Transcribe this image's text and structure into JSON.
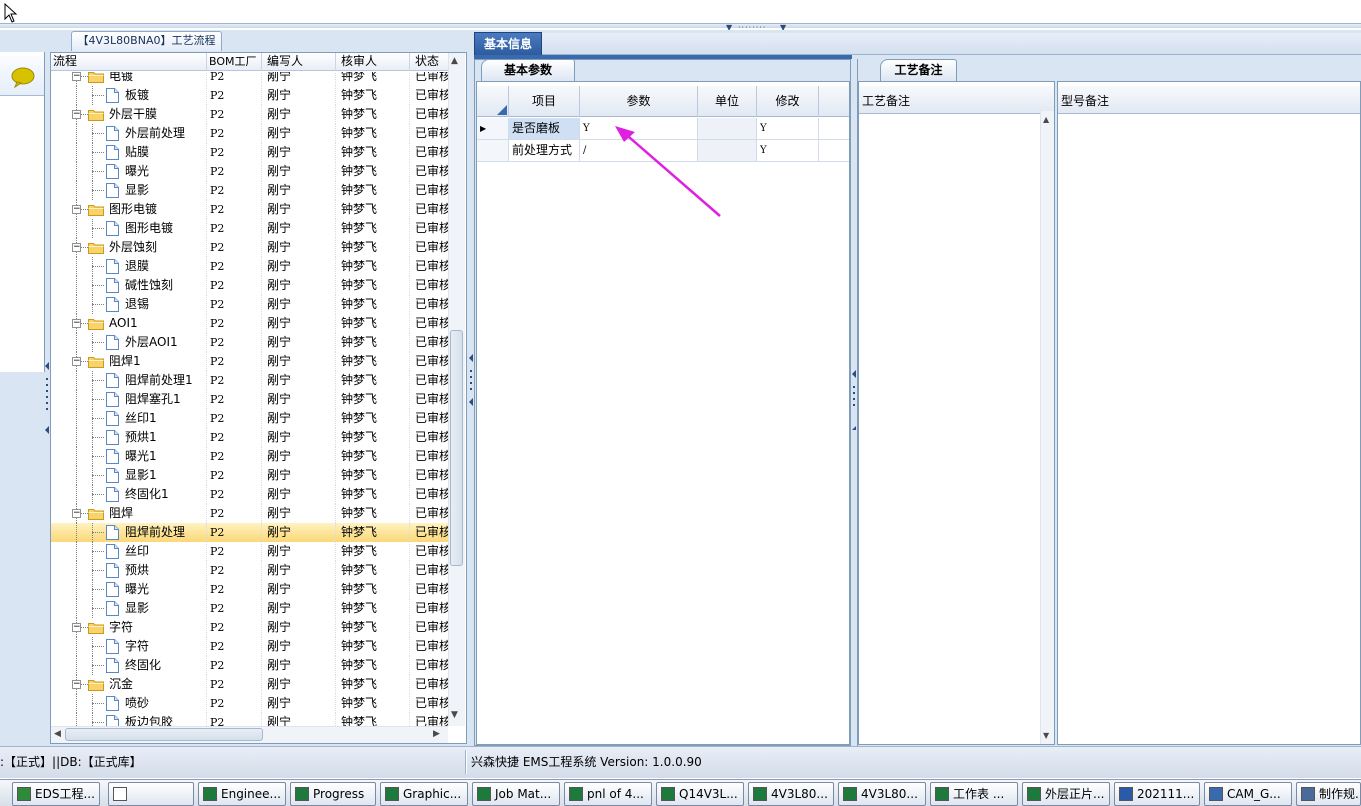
{
  "tree": {
    "caption": "【4V3L80BNA0】工艺流程",
    "columns": [
      "流程",
      "BOM工厂",
      "编写人",
      "核审人",
      "状态"
    ],
    "rows": [
      {
        "label": "电镀",
        "level": 0,
        "bom": "P2",
        "author": "剐宁",
        "reviewer": "钟梦飞",
        "status": "已审核"
      },
      {
        "label": "板镀",
        "level": 1,
        "bom": "P2",
        "author": "剐宁",
        "reviewer": "钟梦飞",
        "status": "已审核"
      },
      {
        "label": "外层干膜",
        "level": 0,
        "bom": "P2",
        "author": "剐宁",
        "reviewer": "钟梦飞",
        "status": "已审核"
      },
      {
        "label": "外层前处理",
        "level": 1,
        "bom": "P2",
        "author": "剐宁",
        "reviewer": "钟梦飞",
        "status": "已审核"
      },
      {
        "label": "贴膜",
        "level": 1,
        "bom": "P2",
        "author": "剐宁",
        "reviewer": "钟梦飞",
        "status": "已审核"
      },
      {
        "label": "曝光",
        "level": 1,
        "bom": "P2",
        "author": "剐宁",
        "reviewer": "钟梦飞",
        "status": "已审核"
      },
      {
        "label": "显影",
        "level": 1,
        "bom": "P2",
        "author": "剐宁",
        "reviewer": "钟梦飞",
        "status": "已审核"
      },
      {
        "label": "图形电镀",
        "level": 0,
        "bom": "P2",
        "author": "剐宁",
        "reviewer": "钟梦飞",
        "status": "已审核"
      },
      {
        "label": "图形电镀",
        "level": 1,
        "bom": "P2",
        "author": "剐宁",
        "reviewer": "钟梦飞",
        "status": "已审核"
      },
      {
        "label": "外层蚀刻",
        "level": 0,
        "bom": "P2",
        "author": "剐宁",
        "reviewer": "钟梦飞",
        "status": "已审核"
      },
      {
        "label": "退膜",
        "level": 1,
        "bom": "P2",
        "author": "剐宁",
        "reviewer": "钟梦飞",
        "status": "已审核"
      },
      {
        "label": "碱性蚀刻",
        "level": 1,
        "bom": "P2",
        "author": "剐宁",
        "reviewer": "钟梦飞",
        "status": "已审核"
      },
      {
        "label": "退锡",
        "level": 1,
        "bom": "P2",
        "author": "剐宁",
        "reviewer": "钟梦飞",
        "status": "已审核"
      },
      {
        "label": "AOI1",
        "level": 0,
        "bom": "P2",
        "author": "剐宁",
        "reviewer": "钟梦飞",
        "status": "已审核"
      },
      {
        "label": "外层AOI1",
        "level": 1,
        "bom": "P2",
        "author": "剐宁",
        "reviewer": "钟梦飞",
        "status": "已审核"
      },
      {
        "label": "阻焊1",
        "level": 0,
        "bom": "P2",
        "author": "剐宁",
        "reviewer": "钟梦飞",
        "status": "已审核"
      },
      {
        "label": "阻焊前处理1",
        "level": 1,
        "bom": "P2",
        "author": "剐宁",
        "reviewer": "钟梦飞",
        "status": "已审核"
      },
      {
        "label": "阻焊塞孔1",
        "level": 1,
        "bom": "P2",
        "author": "剐宁",
        "reviewer": "钟梦飞",
        "status": "已审核"
      },
      {
        "label": "丝印1",
        "level": 1,
        "bom": "P2",
        "author": "剐宁",
        "reviewer": "钟梦飞",
        "status": "已审核"
      },
      {
        "label": "预烘1",
        "level": 1,
        "bom": "P2",
        "author": "剐宁",
        "reviewer": "钟梦飞",
        "status": "已审核"
      },
      {
        "label": "曝光1",
        "level": 1,
        "bom": "P2",
        "author": "剐宁",
        "reviewer": "钟梦飞",
        "status": "已审核"
      },
      {
        "label": "显影1",
        "level": 1,
        "bom": "P2",
        "author": "剐宁",
        "reviewer": "钟梦飞",
        "status": "已审核"
      },
      {
        "label": "终固化1",
        "level": 1,
        "bom": "P2",
        "author": "剐宁",
        "reviewer": "钟梦飞",
        "status": "已审核"
      },
      {
        "label": "阻焊",
        "level": 0,
        "bom": "P2",
        "author": "剐宁",
        "reviewer": "钟梦飞",
        "status": "已审核"
      },
      {
        "label": "阻焊前处理",
        "level": 1,
        "bom": "P2",
        "author": "剐宁",
        "reviewer": "钟梦飞",
        "status": "已审核",
        "selected": true
      },
      {
        "label": "丝印",
        "level": 1,
        "bom": "P2",
        "author": "剐宁",
        "reviewer": "钟梦飞",
        "status": "已审核"
      },
      {
        "label": "预烘",
        "level": 1,
        "bom": "P2",
        "author": "剐宁",
        "reviewer": "钟梦飞",
        "status": "已审核"
      },
      {
        "label": "曝光",
        "level": 1,
        "bom": "P2",
        "author": "剐宁",
        "reviewer": "钟梦飞",
        "status": "已审核"
      },
      {
        "label": "显影",
        "level": 1,
        "bom": "P2",
        "author": "剐宁",
        "reviewer": "钟梦飞",
        "status": "已审核"
      },
      {
        "label": "字符",
        "level": 0,
        "bom": "P2",
        "author": "剐宁",
        "reviewer": "钟梦飞",
        "status": "已审核"
      },
      {
        "label": "字符",
        "level": 1,
        "bom": "P2",
        "author": "剐宁",
        "reviewer": "钟梦飞",
        "status": "已审核"
      },
      {
        "label": "终固化",
        "level": 1,
        "bom": "P2",
        "author": "剐宁",
        "reviewer": "钟梦飞",
        "status": "已审核"
      },
      {
        "label": "沉金",
        "level": 0,
        "bom": "P2",
        "author": "剐宁",
        "reviewer": "钟梦飞",
        "status": "已审核"
      },
      {
        "label": "喷砂",
        "level": 1,
        "bom": "P2",
        "author": "剐宁",
        "reviewer": "钟梦飞",
        "status": "已审核"
      },
      {
        "label": "板边包胶",
        "level": 1,
        "bom": "P2",
        "author": "剐宁",
        "reviewer": "钟梦飞",
        "status": "已审核"
      }
    ]
  },
  "center": {
    "tab": "基本信息",
    "subtab": "基本参数",
    "columns": [
      "项目",
      "参数",
      "单位",
      "修改"
    ],
    "rows": [
      {
        "item": "是否磨板",
        "param": "Y",
        "unit": "",
        "modify": "Y",
        "current": true
      },
      {
        "item": "前处理方式",
        "param": "/",
        "unit": "",
        "modify": "Y"
      }
    ],
    "annotation_color": "#e020e0"
  },
  "right": {
    "tab": "工艺备注",
    "col1": "工艺备注",
    "col2": "型号备注"
  },
  "status": {
    "left": ":【正式】||DB:【正式库】",
    "right": "兴森快捷 EMS工程系统 Version: 1.0.0.90"
  },
  "taskbar": {
    "items": [
      {
        "label": "EDS工程...",
        "icon": "app-icon"
      },
      {
        "label": "",
        "icon": "window-icon"
      },
      {
        "label": "Enginee...",
        "icon": "excel-icon"
      },
      {
        "label": "Progress",
        "icon": "excel-icon"
      },
      {
        "label": "Graphic...",
        "icon": "excel-icon"
      },
      {
        "label": "Job Mat...",
        "icon": "excel-icon"
      },
      {
        "label": "pnl of 4...",
        "icon": "excel-icon"
      },
      {
        "label": "Q14V3L...",
        "icon": "excel-icon"
      },
      {
        "label": "4V3L80...",
        "icon": "excel-icon"
      },
      {
        "label": "4V3L80...",
        "icon": "excel-icon"
      },
      {
        "label": "工作表 ...",
        "icon": "excel-icon"
      },
      {
        "label": "外层正片...",
        "icon": "excel-icon"
      },
      {
        "label": "202111...",
        "icon": "word-icon"
      },
      {
        "label": "CAM_G...",
        "icon": "cam-icon"
      },
      {
        "label": "制作规...",
        "icon": "doc-icon"
      }
    ]
  }
}
